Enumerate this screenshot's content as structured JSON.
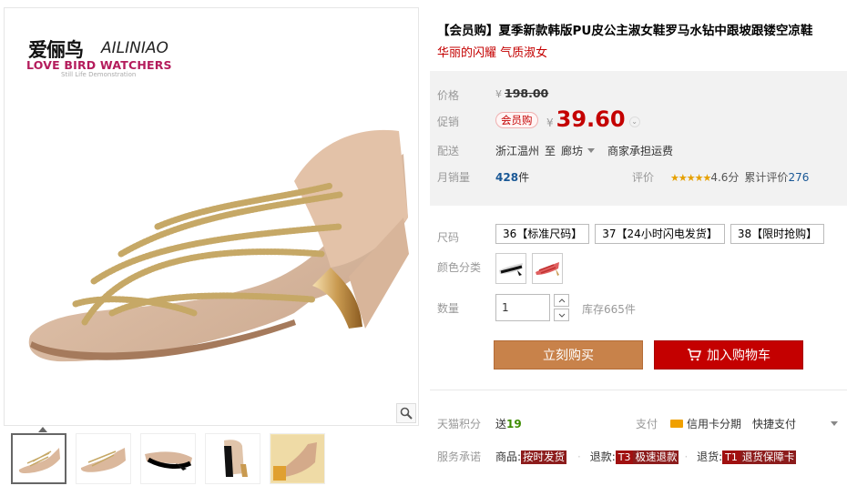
{
  "brand": {
    "cn": "爱俪鸟",
    "en": "AILINIAO",
    "tagline": "LOVE BIRD WATCHERS",
    "sub": "Still Life Demonstration"
  },
  "product": {
    "title": "【会员购】夏季新款韩版PU皮公主淑女鞋罗马水钻中跟坡跟镂空凉鞋",
    "subtitle": "华丽的闪耀 气质淑女"
  },
  "price": {
    "label": "价格",
    "currency": "¥",
    "original": "198.00",
    "promo_label": "促销",
    "vip_badge": "会员购",
    "promo": "39.60"
  },
  "shipping": {
    "label": "配送",
    "from": "浙江温州",
    "to_word": "至",
    "to": "廊坊",
    "note": "商家承担运费"
  },
  "sales": {
    "label": "月销量",
    "count": "428",
    "unit": "件"
  },
  "review": {
    "label": "评价",
    "stars": "★★★★★",
    "score": "4.6分",
    "total_label": "累计评价",
    "total": "276",
    "rating": 4.6
  },
  "sizes": {
    "label": "尺码",
    "options": [
      "36【标准尺码】",
      "37【24小时闪电发货】",
      "38【限时抢购】"
    ]
  },
  "colors": {
    "label": "颜色分类",
    "options": [
      "black-silver",
      "red"
    ]
  },
  "quantity": {
    "label": "数量",
    "value": "1",
    "stock": "库存665件"
  },
  "actions": {
    "buy": "立刻购买",
    "cart": "加入购物车"
  },
  "points": {
    "label": "天猫积分",
    "text": "送",
    "value": "19"
  },
  "payment": {
    "label": "支付",
    "credit": "信用卡分期",
    "quick": "快捷支付"
  },
  "service": {
    "label": "服务承诺",
    "items": [
      {
        "name": "商品:",
        "tag": "按时发货"
      },
      {
        "name": "退款:",
        "code": "T3",
        "tag": "极速退款"
      },
      {
        "name": "退货:",
        "code": "T1",
        "tag": "退货保障卡"
      }
    ]
  },
  "colors_theme": {
    "accent": "#c40000",
    "buy": "#c8824a",
    "cart": "#c40000",
    "link": "#1a5896"
  }
}
